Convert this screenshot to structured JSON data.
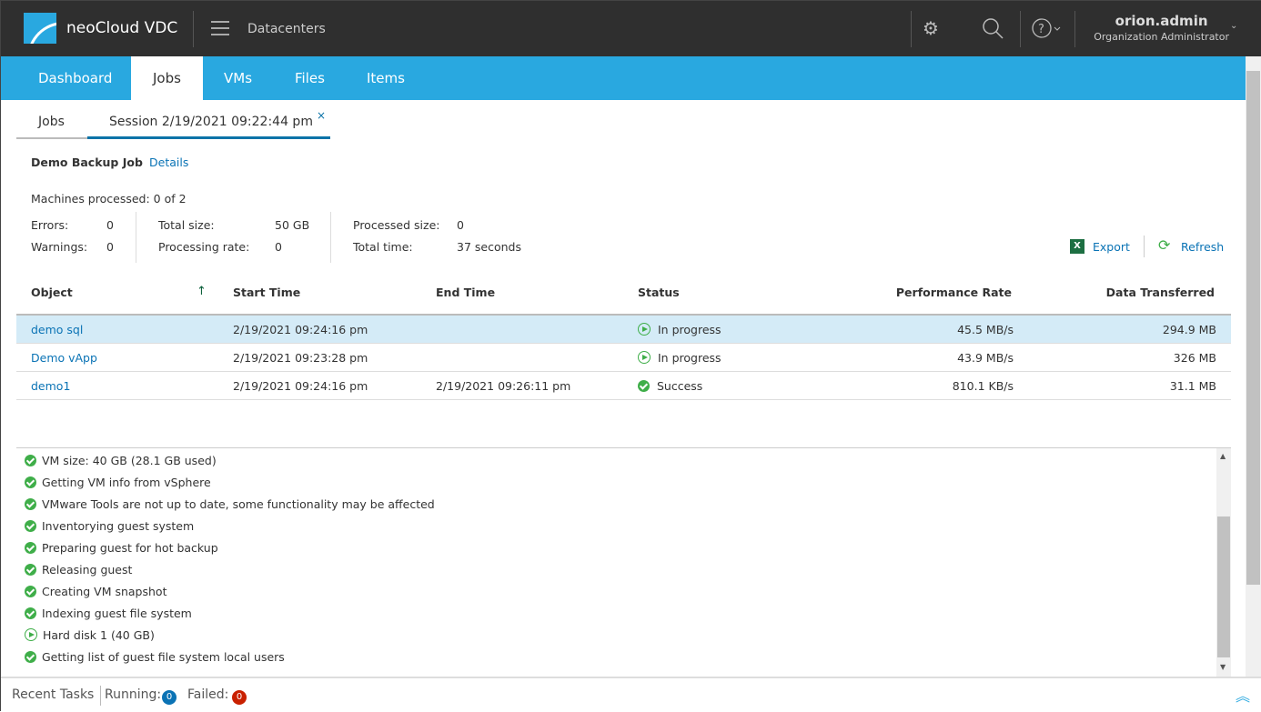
{
  "header": {
    "brand": "neoCloud VDC",
    "section": "Datacenters",
    "user": "orion.admin",
    "role": "Organization Administrator"
  },
  "nav": {
    "tabs": [
      "Dashboard",
      "Jobs",
      "VMs",
      "Files",
      "Items"
    ],
    "active": "Jobs"
  },
  "subtabs": {
    "jobs": "Jobs",
    "session": "Session 2/19/2021 09:22:44 pm",
    "close": "×"
  },
  "job": {
    "name": "Demo Backup Job",
    "details": "Details",
    "machines": "Machines processed: 0 of 2",
    "stats": {
      "errors_label": "Errors:",
      "errors": "0",
      "warnings_label": "Warnings:",
      "warnings": "0",
      "total_size_label": "Total size:",
      "total_size": "50 GB",
      "rate_label": "Processing rate:",
      "rate": "0",
      "processed_label": "Processed size:",
      "processed": "0",
      "time_label": "Total time:",
      "time": "37 seconds"
    }
  },
  "actions": {
    "export": "Export",
    "refresh": "Refresh"
  },
  "table": {
    "headers": [
      "Object",
      "Start Time",
      "End Time",
      "Status",
      "Performance Rate",
      "Data Transferred"
    ],
    "sort_icon": "↑",
    "rows": [
      {
        "object": "demo sql",
        "start": "2/19/2021 09:24:16 pm",
        "end": "",
        "status": "In progress",
        "rate": "45.5 MB/s",
        "data": "294.9 MB"
      },
      {
        "object": "Demo vApp",
        "start": "2/19/2021 09:23:28 pm",
        "end": "",
        "status": "In progress",
        "rate": "43.9 MB/s",
        "data": "326 MB"
      },
      {
        "object": "demo1",
        "start": "2/19/2021 09:24:16 pm",
        "end": "2/19/2021 09:26:11 pm",
        "status": "Success",
        "rate": "810.1 KB/s",
        "data": "31.1 MB"
      }
    ]
  },
  "log": [
    {
      "text": "VM size: 40 GB (28.1 GB used)",
      "state": "success"
    },
    {
      "text": "Getting VM info from vSphere",
      "state": "success"
    },
    {
      "text": "VMware Tools are not up to date, some functionality may be affected",
      "state": "success"
    },
    {
      "text": "Inventorying guest system",
      "state": "success"
    },
    {
      "text": "Preparing guest for hot backup",
      "state": "success"
    },
    {
      "text": "Releasing guest",
      "state": "success"
    },
    {
      "text": "Creating VM snapshot",
      "state": "success"
    },
    {
      "text": "Indexing guest file system",
      "state": "success"
    },
    {
      "text": "Hard disk 1 (40 GB)",
      "state": "running"
    },
    {
      "text": "Getting list of guest file system local users",
      "state": "success"
    }
  ],
  "footer": {
    "recent": "Recent Tasks",
    "running_label": "Running:",
    "running": "0",
    "failed_label": "Failed:",
    "failed": "0"
  },
  "colors": {
    "accent": "#29a8e0",
    "header": "#2f2f2f",
    "success": "#3fae49",
    "link": "#0a73b5",
    "selected_row": "#d4ebf7"
  }
}
